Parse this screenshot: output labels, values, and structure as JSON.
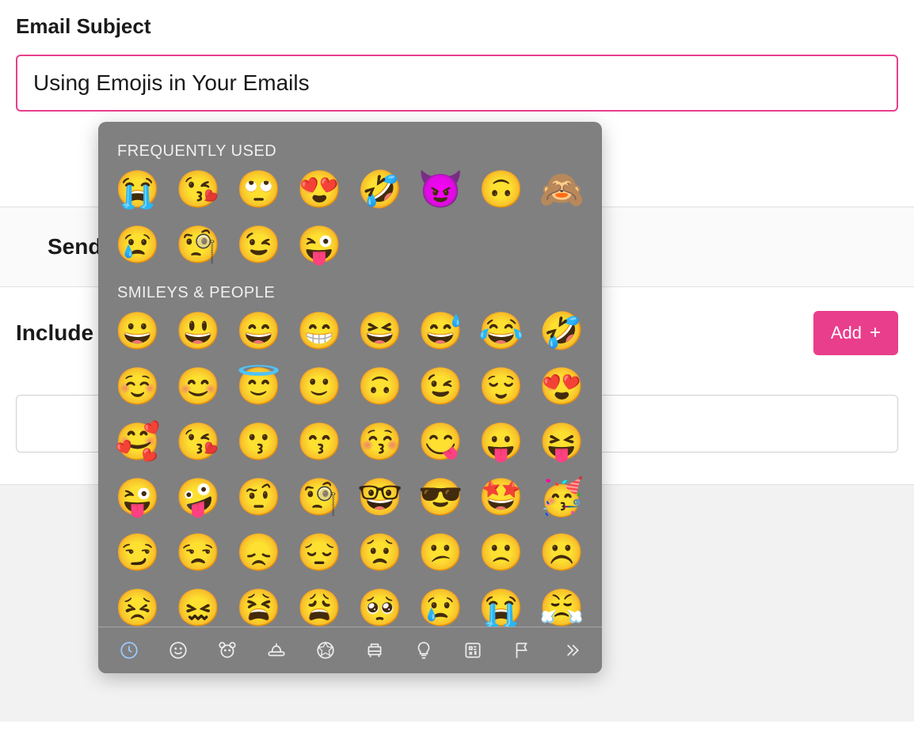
{
  "form": {
    "subject_label": "Email Subject",
    "subject_value": "Using Emojis in Your Emails",
    "send_label": "Send",
    "include_label": "Include",
    "add_button_label": "Add"
  },
  "emoji_picker": {
    "sections": [
      {
        "title": "FREQUENTLY USED",
        "emojis": [
          "😭",
          "😘",
          "🙄",
          "😍",
          "🤣",
          "😈",
          "🙃",
          "🙈",
          "😢",
          "🧐",
          "😉",
          "😜"
        ]
      },
      {
        "title": "SMILEYS & PEOPLE",
        "emojis": [
          "😀",
          "😃",
          "😄",
          "😁",
          "😆",
          "😅",
          "😂",
          "🤣",
          "☺️",
          "😊",
          "😇",
          "🙂",
          "🙃",
          "😉",
          "😌",
          "😍",
          "🥰",
          "😘",
          "😗",
          "😙",
          "😚",
          "😋",
          "😛",
          "😝",
          "😜",
          "🤪",
          "🤨",
          "🧐",
          "🤓",
          "😎",
          "🤩",
          "🥳",
          "😏",
          "😒",
          "😞",
          "😔",
          "😟",
          "😕",
          "🙁",
          "☹️",
          "😣",
          "😖",
          "😫",
          "😩",
          "🥺",
          "😢",
          "😭",
          "😤"
        ]
      }
    ],
    "tabs": [
      "recent",
      "smileys",
      "animals",
      "food",
      "activity",
      "travel",
      "objects",
      "symbols",
      "flags",
      "more"
    ]
  }
}
